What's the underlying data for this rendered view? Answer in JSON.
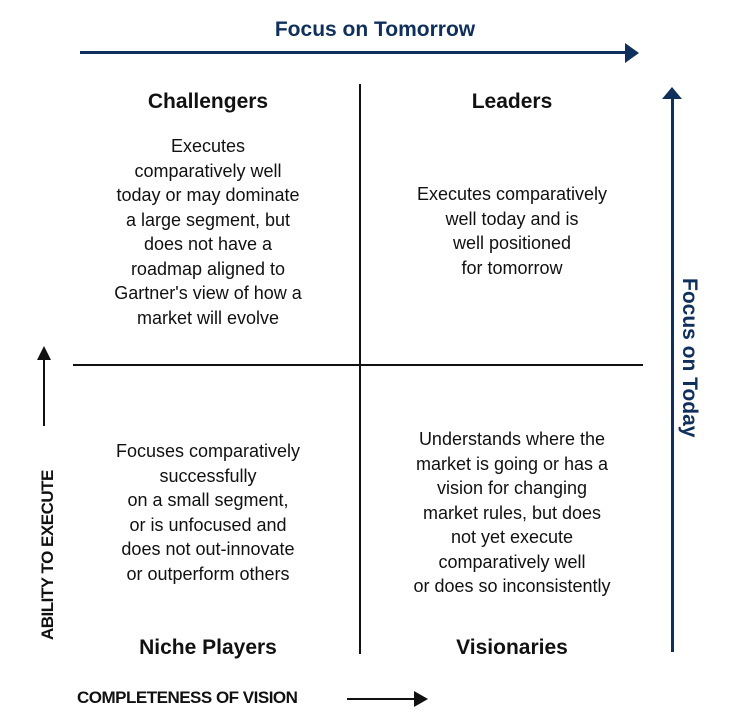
{
  "axes": {
    "top": {
      "label": "Focus on Tomorrow",
      "color": "#0f2f5c"
    },
    "right": {
      "label": "Focus on Today",
      "color": "#0f2f5c"
    },
    "y_axis": {
      "label": "ABILITY TO EXECUTE"
    },
    "x_axis": {
      "label": "COMPLETENESS OF VISION"
    }
  },
  "quadrants": {
    "challengers": {
      "title": "Challengers",
      "description": "Executes\ncomparatively well\ntoday or may dominate\na large segment, but\ndoes not have a\nroadmap aligned to\nGartner's view of how a\nmarket will evolve"
    },
    "leaders": {
      "title": "Leaders",
      "description": "Executes comparatively\nwell today and is\nwell positioned\nfor tomorrow"
    },
    "niche_players": {
      "title": "Niche Players",
      "description": "Focuses comparatively\nsuccessfully\non a small segment,\nor is unfocused and\ndoes not out-innovate\nor outperform others"
    },
    "visionaries": {
      "title": "Visionaries",
      "description": "Understands where the\nmarket is going or has a\nvision for changing\nmarket rules, but does\nnot yet execute\ncomparatively well\nor does so inconsistently"
    }
  }
}
